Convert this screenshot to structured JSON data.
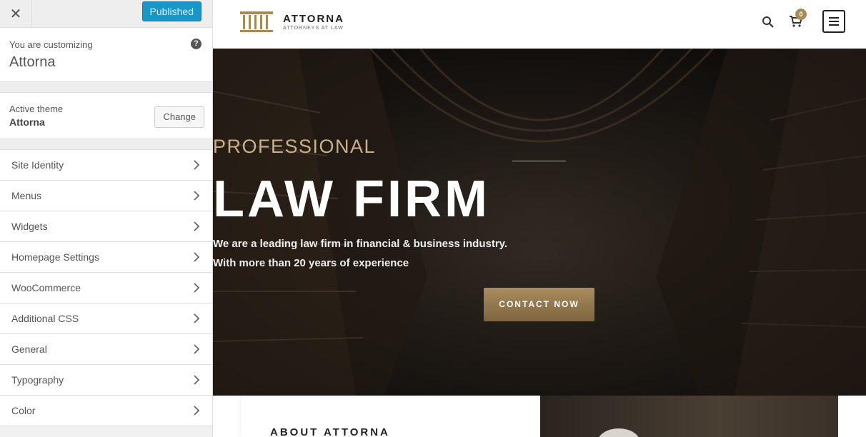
{
  "sidebar": {
    "close_icon": "close-icon",
    "publish_label": "Published",
    "customizing_caption": "You are customizing",
    "customizing_title": "Attorna",
    "help_icon": "question-circle-icon",
    "active_theme_caption": "Active theme",
    "active_theme_name": "Attorna",
    "change_label": "Change",
    "items": [
      {
        "label": "Site Identity"
      },
      {
        "label": "Menus"
      },
      {
        "label": "Widgets"
      },
      {
        "label": "Homepage Settings"
      },
      {
        "label": "WooCommerce"
      },
      {
        "label": "Additional CSS"
      },
      {
        "label": "General"
      },
      {
        "label": "Typography"
      },
      {
        "label": "Color"
      }
    ]
  },
  "site": {
    "logo_name": "ATTORNA",
    "logo_tagline": "ATTORNEYS AT LAW",
    "cart_count": "0",
    "accent_color": "#a88a55",
    "hero": {
      "kicker": "PROFESSIONAL",
      "title": "LAW FIRM",
      "subtitle_line1": "We are a leading law firm in financial & business industry.",
      "subtitle_line2": "With more than 20 years of experience",
      "cta_label": "CONTACT NOW"
    },
    "about_title": "ABOUT ATTORNA"
  }
}
